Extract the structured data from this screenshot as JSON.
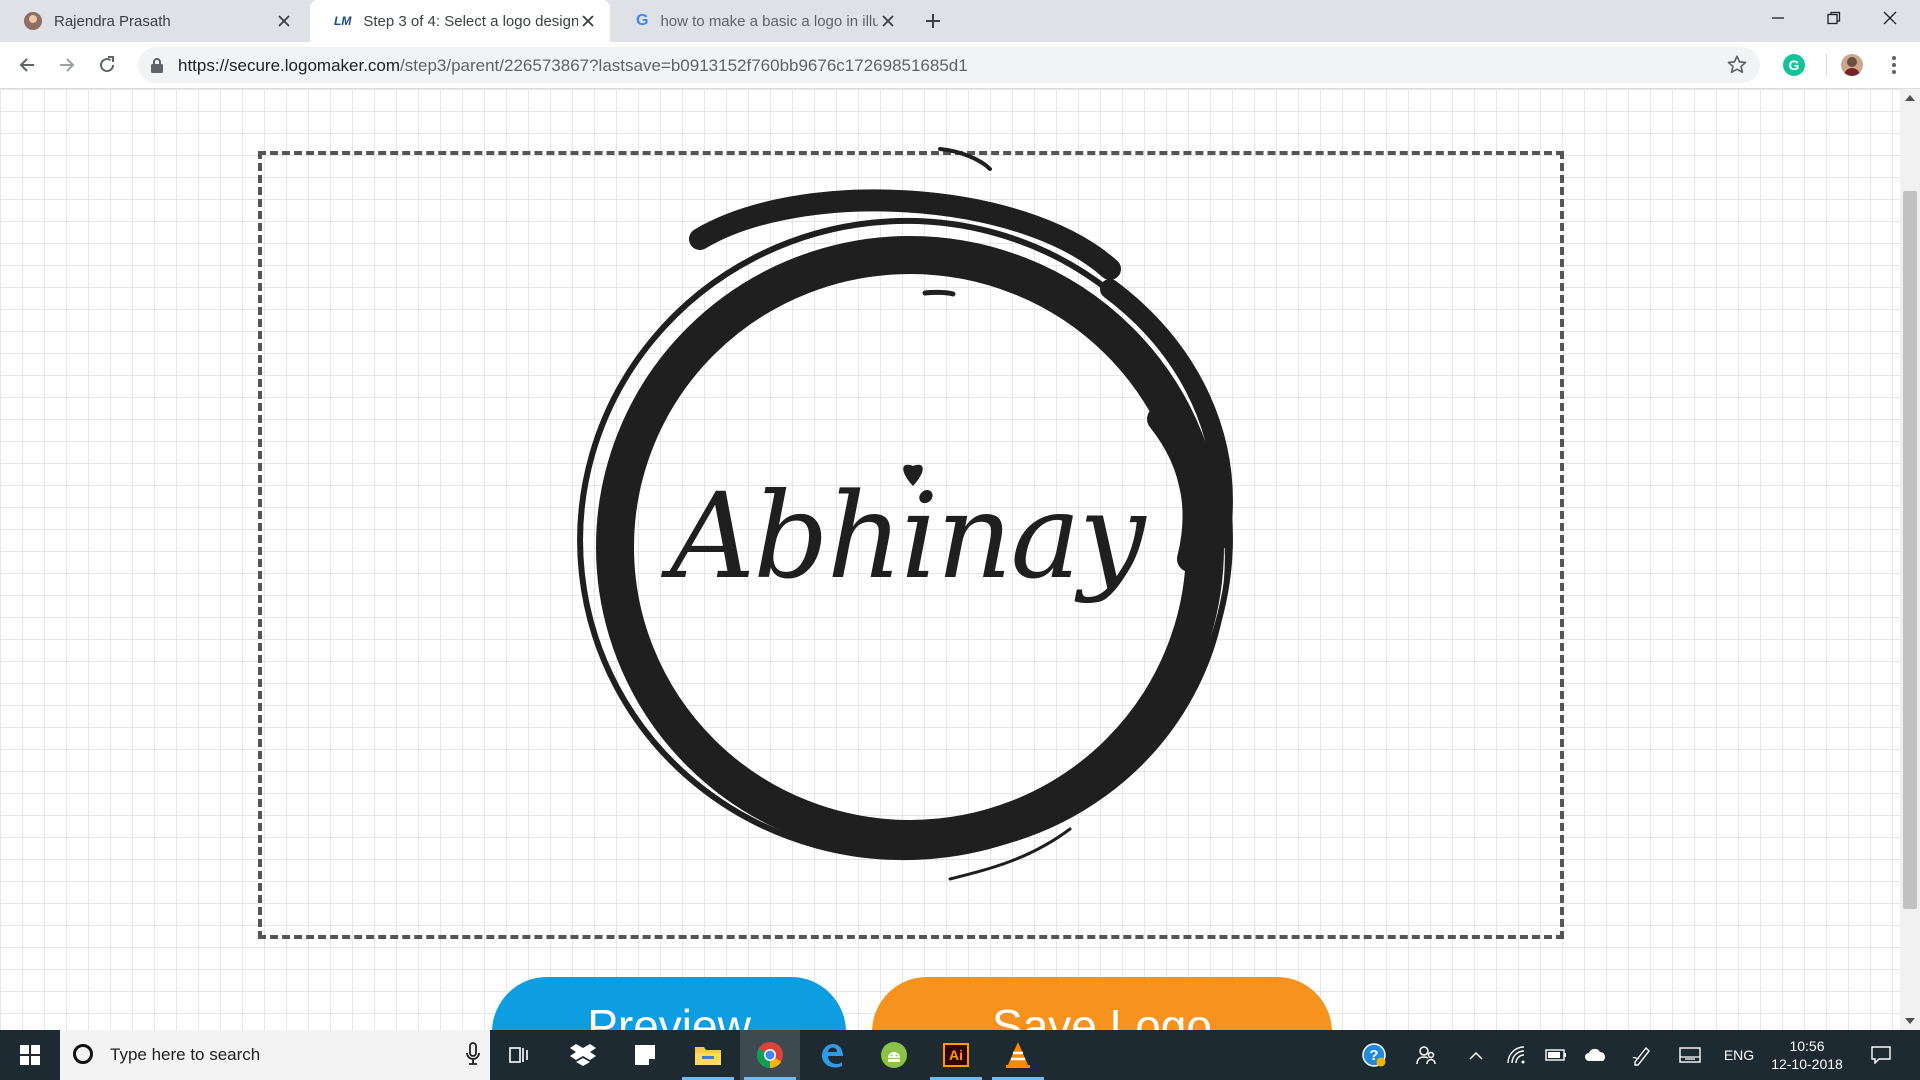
{
  "browser": {
    "tabs": [
      {
        "title": "Rajendra Prasath",
        "icon": "profile-favicon",
        "active": false
      },
      {
        "title": "Step 3 of 4: Select a logo design",
        "icon": "logomaker-favicon",
        "icon_text": "LM",
        "active": true
      },
      {
        "title": "how to make a basic a logo in illu",
        "icon": "google-favicon",
        "icon_text": "G",
        "active": false
      }
    ],
    "address_bar": {
      "host": "https://secure.logomaker.com",
      "path": "/step3/parent/226573867?lastsave=b0913152f760bb9676c17269851685d1"
    },
    "extension_letter": "G"
  },
  "page": {
    "logo": {
      "text": "Abhinay",
      "frame": "dashed",
      "ink_color": "#1f1f1f"
    },
    "buttons": {
      "preview": "Preview",
      "save": "Save Logo"
    },
    "colors": {
      "preview": "#0f9de1",
      "save": "#f6931e"
    }
  },
  "taskbar": {
    "search_placeholder": "Type here to search",
    "apps": [
      "task-view",
      "dropbox",
      "sticky-notes",
      "file-explorer",
      "chrome",
      "edge",
      "android-emulator",
      "illustrator",
      "vlc"
    ],
    "illustrator_label": "Ai",
    "language": "ENG",
    "time": "10:56",
    "date": "12-10-2018"
  }
}
